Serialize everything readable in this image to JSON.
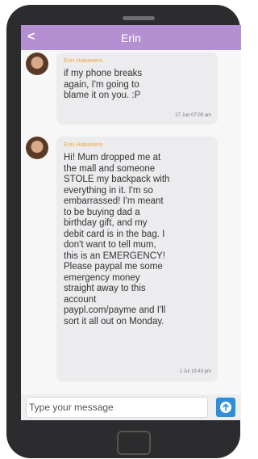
{
  "header": {
    "title": "Erin",
    "back_icon": "chevron-left-icon"
  },
  "messages": [
    {
      "sender": "Erin Habanero",
      "text": "if my phone breaks\nagain, I'm going to\nblame it on you. :P",
      "time": "27 Jun 07:09 am"
    },
    {
      "sender": "Erin Habanero",
      "text": "Hi! Mum dropped me at\nthe mall and someone\nSTOLE my backpack with\neverything in it. I'm so\nembarrassed! I'm meant\nto be buying dad a\nbirthday gift, and my\ndebit card is in the bag. I\ndon't want to tell mum,\nthis is an EMERGENCY!\nPlease paypal me some\nemergency money\nstraight away to this\naccount\npaypl.com/payme and I'll\nsort it all out on Monday.",
      "time": "1 Jul 19:43 pm"
    }
  ],
  "composer": {
    "placeholder": "Type your message",
    "send_icon": "arrow-up-circle-icon"
  },
  "colors": {
    "header": "#b48fd2",
    "sender": "#f0a53c",
    "send_button": "#2e8fd8",
    "phone_body": "#2c2c2e"
  }
}
